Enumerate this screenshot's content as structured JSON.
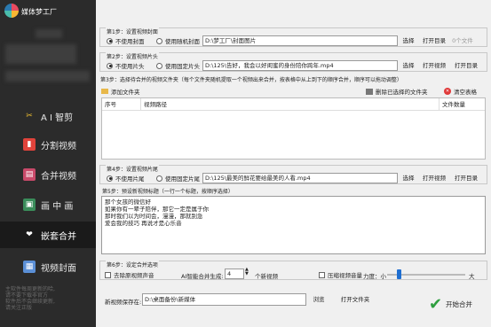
{
  "app": {
    "title": "媒体梦工厂"
  },
  "sidebar": {
    "items": [
      {
        "label": "A I 智剪",
        "icon": "ai-cut-icon"
      },
      {
        "label": "分割视频",
        "icon": "split-video-icon"
      },
      {
        "label": "合并视频",
        "icon": "merge-video-icon"
      },
      {
        "label": "画 中 画",
        "icon": "picture-in-picture-icon"
      },
      {
        "label": "嵌套合并",
        "icon": "nested-merge-icon"
      },
      {
        "label": "视频封面",
        "icon": "video-cover-icon"
      }
    ],
    "tips": "主软件每周更新的哈,\n请不要下载非官方\n软件后不会继续更新,\n请关注正版"
  },
  "step1": {
    "title": "第1步：设置视频封面",
    "option_no": "不使用封面",
    "option_random": "使用随机封面",
    "path": "D:\\梦工厂\\封面图片",
    "select": "选择",
    "open_dir": "打开目录",
    "count": "0个文件"
  },
  "step2": {
    "title": "第2步：设置视频片头",
    "option_no": "不使用片头",
    "option_fixed": "使用固定片头",
    "path": "D:\\125\\告好，我会以好闺蜜的身份陪你跨年.mp4",
    "select": "选择",
    "open_video": "打开视频",
    "open_dir": "打开目录"
  },
  "step3": {
    "title": "第3步：选择待合并的视频文件夹（每个文件夹随机提取一个视频出来合并，按表格中从上到下的顺序合并，顺序可以拖动调整）",
    "add_folder": "添加文件夹",
    "delete_selected": "删除已选择的文件夹",
    "clear_table": "清空表格",
    "columns": [
      "序号",
      "视频路径",
      "文件数量"
    ]
  },
  "step4": {
    "title": "第4步：设置视频片尾",
    "option_no": "不使用片尾",
    "option_fixed": "使用固定片尾",
    "path": "D:\\125\\最美的鲜花要给最美的人看.mp4",
    "select": "选择",
    "open_video": "打开视频",
    "open_dir": "打开目录"
  },
  "step5": {
    "title": "第5步：预设新视频标题（一行一个标题，按顺序选择）",
    "text": "那个女孩的微信好\n如果你有一辈子陪伴，那它一定是属于你\n那时我们以为时间会，漫漫，那就别急\n爱会我的技巧 再说才是心乐音"
  },
  "step6": {
    "title": "第6步：设定合并选项",
    "remove_audio": "去除原视频声音",
    "ai_label": "AI智能合并生成:",
    "ai_count": "4",
    "ai_suffix": "个新视频",
    "compress_audio": "压缩视频音量",
    "strength": "力度：小",
    "strength_max": "大",
    "strength_level": 0.15,
    "save_label": "新视频保存在:",
    "save_path": "D:\\桌面备份\\新媒体",
    "browse": "浏览",
    "open_folder": "打开文件夹",
    "start": "开始合并"
  },
  "colors": {
    "sidebar_bg": "#2b2b2b",
    "active_bg": "#1a1a1a",
    "accent": "#1f6fd1",
    "start_check": "#2e9e3e"
  }
}
